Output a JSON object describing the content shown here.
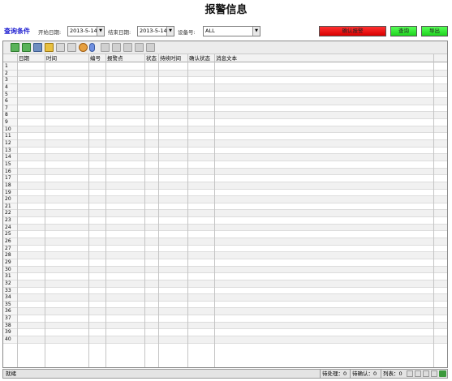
{
  "window": {
    "title": "报警信息"
  },
  "query": {
    "title": "查询条件",
    "start_label": "开始日期:",
    "start_value": "2013-5-14",
    "end_label": "结束日期:",
    "end_value": "2013-5-14",
    "device_label": "设备号:",
    "device_value": "ALL"
  },
  "buttons": {
    "confirm_alarm": "确认报警",
    "query": "查询",
    "export": "导出"
  },
  "table": {
    "columns": [
      "日期",
      "时间",
      "编号",
      "报警点",
      "状态",
      "持续时间",
      "确认状态",
      "消息文本"
    ],
    "row_numbers": [
      "1",
      "2",
      "3",
      "4",
      "5",
      "6",
      "7",
      "8",
      "9",
      "10",
      "11",
      "12",
      "13",
      "14",
      "15",
      "16",
      "17",
      "18",
      "19",
      "20",
      "21",
      "22",
      "23",
      "24",
      "25",
      "26",
      "27",
      "28",
      "29",
      "30",
      "31",
      "32",
      "33",
      "34",
      "35",
      "36",
      "37",
      "38",
      "39",
      "40"
    ]
  },
  "toolbar_icons": [
    "add-icon",
    "add-row-icon",
    "save-icon",
    "lock-icon",
    "edit-icon",
    "check-icon",
    "user-icon",
    "info-icon",
    "move-up-icon",
    "move-down-icon",
    "import-icon",
    "export-icon",
    "delete-icon"
  ],
  "status": {
    "ready": "就绪",
    "pending": "待处理：0",
    "to_confirm": "待确认：0",
    "list": "列表：0"
  },
  "colors": {
    "confirm_button": "#e60000",
    "query_button": "#33e633",
    "title_query": "#1a1ad0"
  }
}
